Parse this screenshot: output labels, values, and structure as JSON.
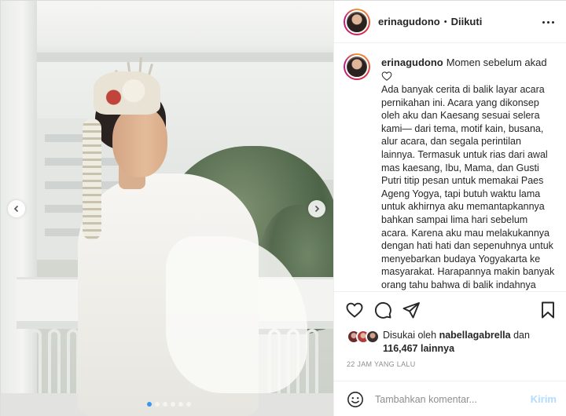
{
  "post": {
    "username": "erinagudono",
    "separator": "•",
    "follow_status": "Diikuti",
    "more_icon": "more-horizontal-icon"
  },
  "caption": {
    "username": "erinagudono",
    "first_line": "Momen sebelum akad",
    "emoji_icon": "white-heart-icon",
    "text": "Ada banyak cerita di balik layar acara pernikahan ini. Acara yang dikonsep oleh aku dan Kaesang sesuai selera kami— dari tema, motif kain, busana, alur acara, dan segala perintilan lainnya. Termasuk untuk rias dari awal mas kaesang, Ibu, Mama, dan Gusti Putri titip pesan untuk memakai Paes Ageng Yogya, tapi butuh waktu lama untuk akhirnya aku memantapkannya bahkan sampai lima hari sebelum acara. Karena aku mau melakukannya dengan hati hati dan sepenuhnya untuk menyebarkan budaya Yogyakarta ke masyarakat. Harapannya makin banyak orang tahu bahwa di balik indahnya riasan Paes"
  },
  "actions": {
    "like_icon": "heart-icon",
    "comment_icon": "comment-icon",
    "share_icon": "paper-plane-icon",
    "save_icon": "bookmark-icon"
  },
  "likes": {
    "prefix": "Disukai oleh",
    "liker": "nabellagabrella",
    "conjunction": "dan",
    "count": "116,467 lainnya"
  },
  "timestamp": "22 JAM YANG LALU",
  "comment": {
    "placeholder": "Tambahkan komentar...",
    "post_label": "Kirim",
    "emoji_icon": "smiley-icon"
  },
  "carousel": {
    "total_slides": 6,
    "active_slide": 1,
    "prev_icon": "chevron-left-icon",
    "next_icon": "chevron-right-icon"
  },
  "colors": {
    "accent_blue": "#3897f0",
    "post_button_disabled": "#b3dbff",
    "muted_text": "#8e8e8e"
  }
}
